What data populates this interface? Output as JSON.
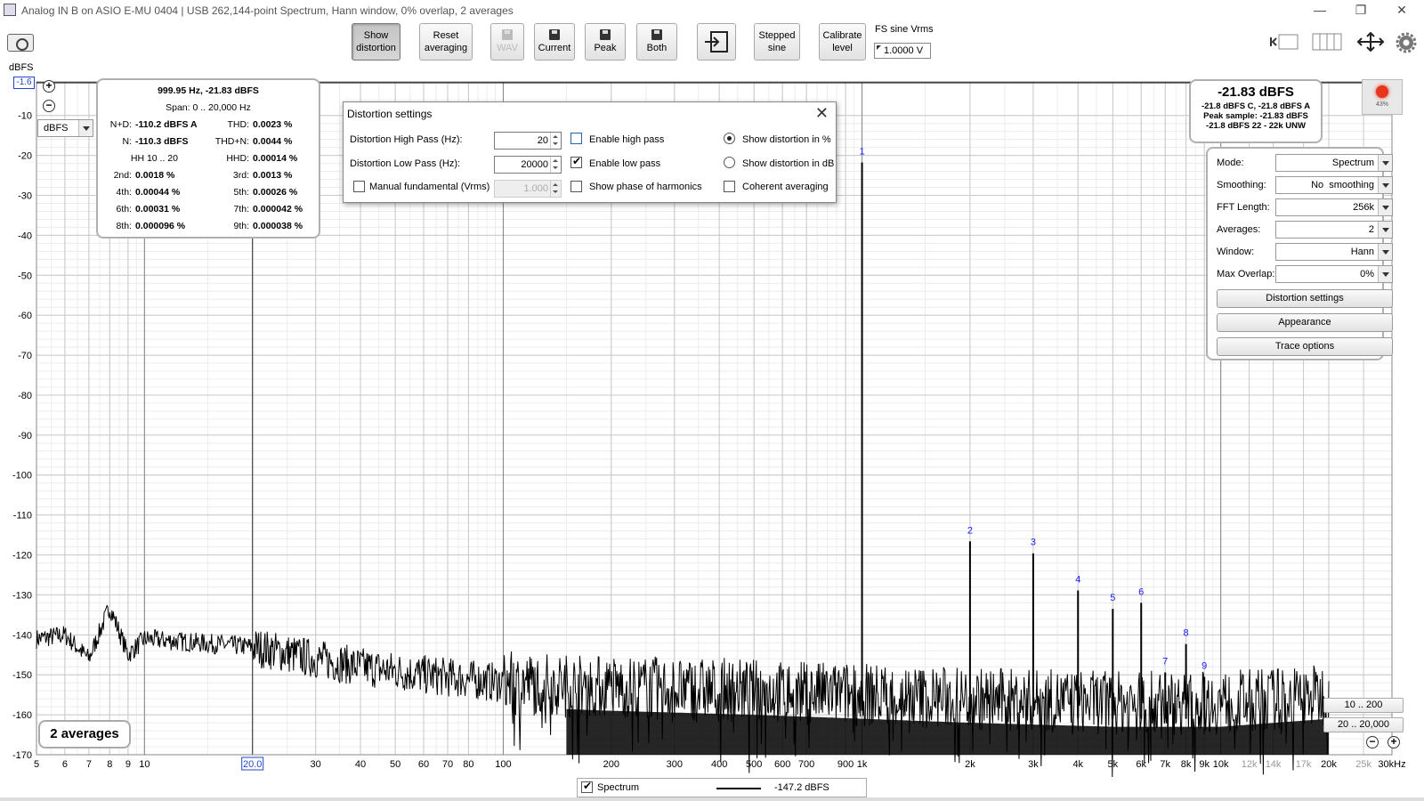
{
  "window": {
    "title": "Analog IN B on ASIO E-MU 0404 | USB 262,144-point Spectrum, Hann window, 0% overlap, 2 averages",
    "minimize": "—",
    "restore": "❐",
    "close": "✕"
  },
  "toolbar": {
    "show_distortion": [
      "Show",
      "distortion"
    ],
    "reset_averaging": [
      "Reset",
      "averaging"
    ],
    "wav": "WAV",
    "current": "Current",
    "peak": "Peak",
    "both": "Both",
    "stepped_sine": [
      "Stepped",
      "sine"
    ],
    "calibrate_level": [
      "Calibrate",
      "level"
    ],
    "fs_sine_label": "FS sine Vrms",
    "fs_sine_value": "1.0000 V"
  },
  "plot": {
    "y_unit_label": "dBFS",
    "y_top_value": "-1.6",
    "unit_select": "dBFS",
    "x_unit": "kHz",
    "background": "#ffffff",
    "trace_color": "#000000",
    "harmonic_label_color": "#1a1aff"
  },
  "distortion_readout": {
    "header": "999.95 Hz, -21.83 dBFS",
    "span": "Span: 0 .. 20,000 Hz",
    "rows": [
      {
        "l1": "N+D:",
        "v1": "-110.2 dBFS A",
        "l2": "THD:",
        "v2": "0.0023 %"
      },
      {
        "l1": "N:",
        "v1": "-110.3 dBFS",
        "l2": "THD+N:",
        "v2": "0.0044 %"
      },
      {
        "l1": "HH 10 .. 20",
        "v1": "",
        "l2": "HHD:",
        "v2": "0.00014 %"
      },
      {
        "l1": "2nd:",
        "v1": "0.0018 %",
        "l2": "3rd:",
        "v2": "0.0013 %"
      },
      {
        "l1": "4th:",
        "v1": "0.00044 %",
        "l2": "5th:",
        "v2": "0.00026 %"
      },
      {
        "l1": "6th:",
        "v1": "0.00031 %",
        "l2": "7th:",
        "v2": "0.000042 %"
      },
      {
        "l1": "8th:",
        "v1": "0.000096 %",
        "l2": "9th:",
        "v2": "0.000038 %"
      }
    ]
  },
  "dialog": {
    "title": "Distortion settings",
    "high_pass_label": "Distortion High Pass (Hz):",
    "high_pass_value": "20",
    "low_pass_label": "Distortion Low Pass (Hz):",
    "low_pass_value": "20000",
    "manual_fundamental_label": "Manual fundamental (Vrms)",
    "manual_fundamental_value": "1.000",
    "enable_high_pass": "Enable high pass",
    "enable_low_pass": "Enable low pass",
    "show_phase": "Show phase of harmonics",
    "show_percent": "Show distortion in %",
    "show_db": "Show distortion in dB",
    "coherent": "Coherent averaging"
  },
  "level_readout": {
    "main": "-21.83 dBFS",
    "line1": "-21.8 dBFS C, -21.8 dBFS A",
    "line2": "Peak sample: -21.83 dBFS",
    "line3": "-21.8 dBFS 22 - 22k UNW"
  },
  "record": {
    "percent": "43%"
  },
  "settings": {
    "mode_label": "Mode:",
    "mode": "Spectrum",
    "smoothing_label": "Smoothing:",
    "smoothing": "No  smoothing",
    "fft_label": "FFT Length:",
    "fft": "256k",
    "averages_label": "Averages:",
    "averages": "2",
    "window_label": "Window:",
    "window": "Hann",
    "overlap_label": "Max Overlap:",
    "overlap": "0%",
    "distortion_settings": "Distortion settings",
    "appearance": "Appearance",
    "trace_options": "Trace options"
  },
  "averages_badge": "2 averages",
  "range_buttons": [
    "10 .. 200",
    "20 .. 20,000"
  ],
  "legend": {
    "name": "Spectrum",
    "value": "-147.2 dBFS"
  },
  "chart_data": {
    "type": "line",
    "title": "",
    "xlabel": "",
    "ylabel": "dBFS",
    "x_scale": "log",
    "xlim": [
      5,
      30000
    ],
    "ylim": [
      -170,
      -1.6
    ],
    "x_ticks": [
      5,
      6,
      7,
      8,
      9,
      10,
      20,
      30,
      40,
      50,
      60,
      70,
      80,
      100,
      200,
      300,
      400,
      500,
      600,
      700,
      900,
      1000,
      2000,
      3000,
      4000,
      5000,
      6000,
      7000,
      8000,
      9000,
      10000,
      12000,
      14000,
      17000,
      20000,
      25000,
      30000
    ],
    "x_tick_labels": [
      "5",
      "6",
      "7",
      "8",
      "9",
      "10",
      "20.0",
      "30",
      "40",
      "50",
      "60",
      "70",
      "80",
      "100",
      "200",
      "300",
      "400",
      "500",
      "600",
      "700",
      "900",
      "1k",
      "2k",
      "3k",
      "4k",
      "5k",
      "6k",
      "7k",
      "8k",
      "9k",
      "10k",
      "12k",
      "14k",
      "17k",
      "20k",
      "25k",
      "30kHz"
    ],
    "y_ticks": [
      -10,
      -20,
      -30,
      -40,
      -50,
      -60,
      -70,
      -80,
      -90,
      -100,
      -110,
      -120,
      -130,
      -140,
      -150,
      -160,
      -170
    ],
    "grid": true,
    "cursor_x": 20,
    "series": [
      {
        "name": "Spectrum",
        "noise_floor": [
          [
            5,
            -141
          ],
          [
            6,
            -140
          ],
          [
            7,
            -146
          ],
          [
            8,
            -133
          ],
          [
            9,
            -145
          ],
          [
            10,
            -141
          ],
          [
            20,
            -143
          ],
          [
            30,
            -146
          ],
          [
            40,
            -148
          ],
          [
            60,
            -150
          ],
          [
            100,
            -152
          ],
          [
            200,
            -153
          ],
          [
            500,
            -154
          ],
          [
            1000,
            -155
          ],
          [
            2000,
            -156
          ],
          [
            5000,
            -157
          ],
          [
            10000,
            -157
          ],
          [
            20000,
            -155
          ]
        ],
        "peaks": [
          {
            "label": "1",
            "freq": 1000,
            "db": -21.8
          },
          {
            "label": "2",
            "freq": 2000,
            "db": -116.6
          },
          {
            "label": "3",
            "freq": 3000,
            "db": -119.6
          },
          {
            "label": "4",
            "freq": 4000,
            "db": -128.9
          },
          {
            "label": "5",
            "freq": 5000,
            "db": -133.5
          },
          {
            "label": "6",
            "freq": 6000,
            "db": -132.0
          },
          {
            "label": "7",
            "freq": 7000,
            "db": -149.4
          },
          {
            "label": "8",
            "freq": 8000,
            "db": -142.3
          },
          {
            "label": "9",
            "freq": 9000,
            "db": -150.5
          }
        ]
      }
    ]
  }
}
